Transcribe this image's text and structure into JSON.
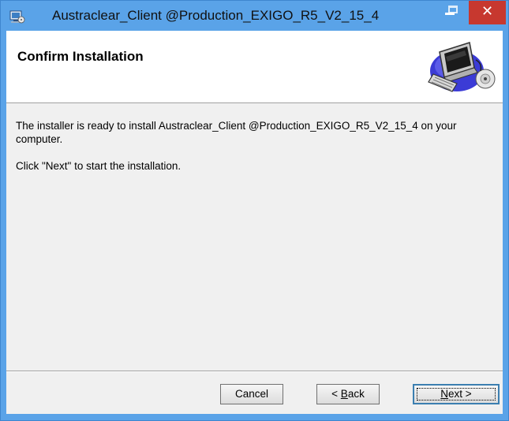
{
  "window": {
    "title": "Austraclear_Client @Production_EXIGO_R5_V2_15_4",
    "close_glyph": "✕",
    "app_icon": "installer-icon"
  },
  "header": {
    "title": "Confirm Installation",
    "graphic": "computer-cd-icon"
  },
  "body": {
    "paragraph1": "The installer is ready to install Austraclear_Client @Production_EXIGO_R5_V2_15_4 on your computer.",
    "paragraph2": "Click \"Next\" to start the installation."
  },
  "buttons": {
    "cancel_label": "Cancel",
    "back_prefix": "< ",
    "back_mnemonic": "B",
    "back_rest": "ack",
    "next_mnemonic": "N",
    "next_rest": "ext >"
  },
  "colors": {
    "titlebar": "#5aa3e8",
    "close_button": "#c7382f",
    "client_bg": "#f0f0f0"
  }
}
